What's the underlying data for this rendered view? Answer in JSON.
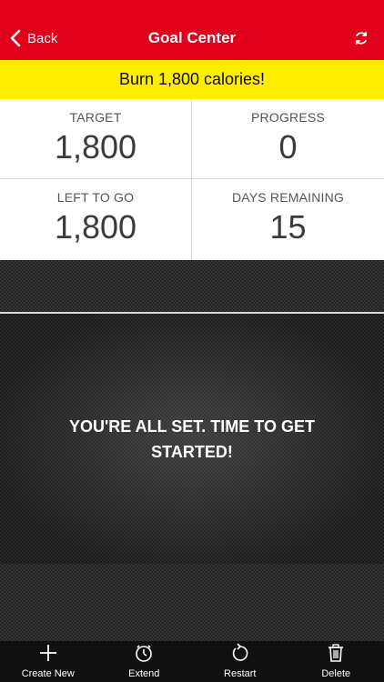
{
  "header": {
    "back_label": "Back",
    "title": "Goal Center",
    "back_icon": "chevron-left-icon",
    "refresh_icon": "refresh-icon"
  },
  "goal": {
    "text": "Burn 1,800 calories!"
  },
  "stats": [
    {
      "label": "TARGET",
      "value": "1,800"
    },
    {
      "label": "PROGRESS",
      "value": "0"
    },
    {
      "label": "LEFT TO GO",
      "value": "1,800"
    },
    {
      "label": "DAYS REMAINING",
      "value": "15"
    }
  ],
  "message": {
    "text": "YOU'RE ALL SET. TIME TO GET STARTED!"
  },
  "tabbar": {
    "items": [
      {
        "label": "Create New",
        "icon": "plus-icon"
      },
      {
        "label": "Extend",
        "icon": "stopwatch-icon"
      },
      {
        "label": "Restart",
        "icon": "restart-icon"
      },
      {
        "label": "Delete",
        "icon": "trash-icon"
      }
    ]
  },
  "colors": {
    "header_bg": "#e0001b",
    "banner_bg": "#ffed00",
    "tabbar_bg": "#111111"
  }
}
